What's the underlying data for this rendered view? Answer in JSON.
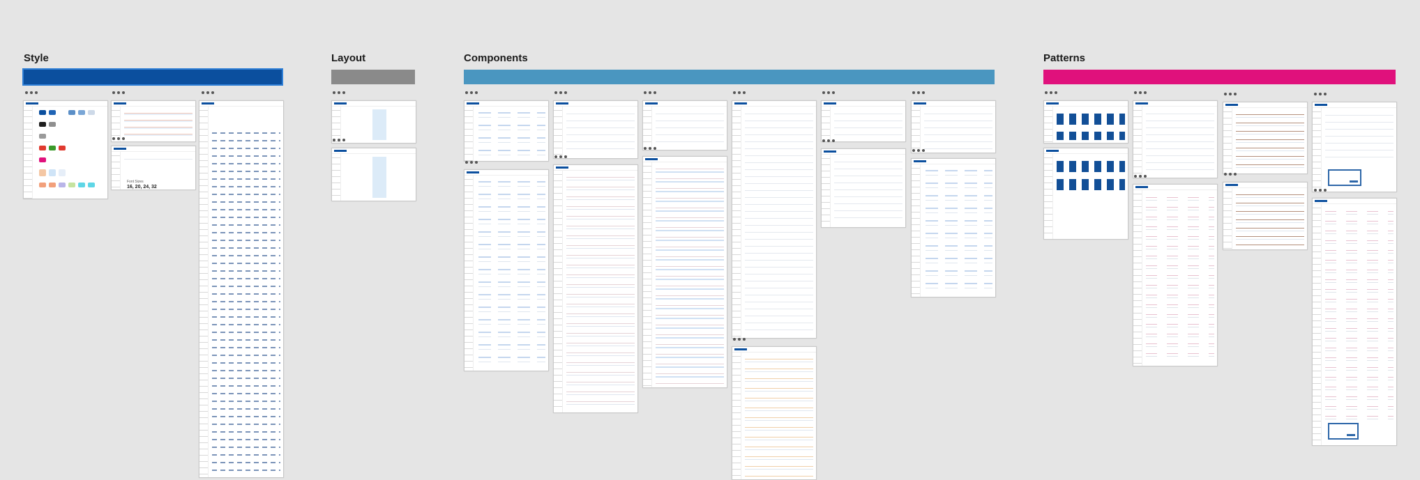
{
  "sections": {
    "style": {
      "title": "Style",
      "color": "#0b4f9e"
    },
    "layout": {
      "title": "Layout",
      "color": "#8a8a8a"
    },
    "components": {
      "title": "Components",
      "color": "#4a96c0"
    },
    "patterns": {
      "title": "Patterns",
      "color": "#e0117c"
    }
  },
  "style_frames": {
    "type_scale_label": "Font Sizes",
    "type_scale_value": "16, 20, 24, 32"
  },
  "palette": {
    "blue": "#0b4f9e",
    "mid_blue": "#2d66a8",
    "light_blue": "#5b8fc7",
    "black": "#1e1e1e",
    "gray": "#8f8f8f",
    "pink": "#e0117c",
    "red": "#e03a2f",
    "green": "#3a9a2a",
    "orange": "#f2a07b",
    "lavender": "#b9b5e8",
    "cyan": "#5fd6e6",
    "peach": "#f4c7a4",
    "sky": "#cfe4f7"
  }
}
